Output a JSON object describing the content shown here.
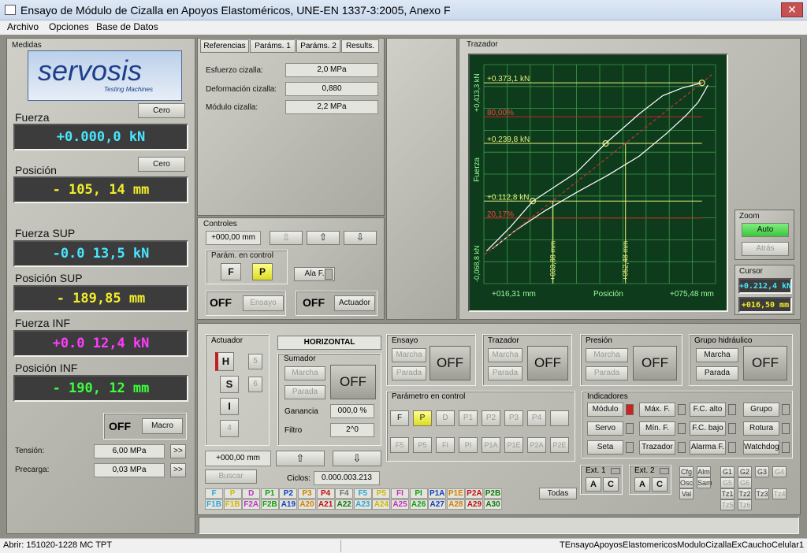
{
  "window": {
    "title": "Ensayo de Módulo de Cizalla en Apoyos Elastoméricos, UNE-EN 1337-3:2005, Anexo F",
    "close": "✕"
  },
  "menu": [
    "Archivo",
    "Opciones",
    "Base de Datos"
  ],
  "medidas": {
    "label": "Medidas",
    "logo": "servosis",
    "logo_sub": "Testing Machines",
    "cero": "Cero",
    "fuerza": {
      "label": "Fuerza",
      "value": "+0.000,0 kN"
    },
    "posicion": {
      "label": "Posición",
      "value": "- 105, 14 mm"
    },
    "fuerza_sup": {
      "label": "Fuerza SUP",
      "value": "-0.0 13,5 kN"
    },
    "posicion_sup": {
      "label": "Posición SUP",
      "value": "- 189,85 mm"
    },
    "fuerza_inf": {
      "label": "Fuerza INF",
      "value": "+0.0 12,4 kN"
    },
    "posicion_inf": {
      "label": "Posición INF",
      "value": "- 190, 12 mm"
    },
    "macro_state": "OFF",
    "macro": "Macro",
    "tension": {
      "label": "Tensión:",
      "value": "6,00 MPa"
    },
    "precarga": {
      "label": "Precarga:",
      "value": "0,03 MPa"
    },
    "arrow": ">>"
  },
  "tabs": [
    "Referencias",
    "Paráms. 1",
    "Paráms. 2",
    "Results."
  ],
  "results": [
    {
      "label": "Esfuerzo cizalla:",
      "value": "2,0 MPa"
    },
    {
      "label": "Deformación cizalla:",
      "value": "0,880"
    },
    {
      "label": "Módulo cizalla:",
      "value": "2,2 MPa"
    }
  ],
  "controles": {
    "label": "Controles",
    "pos": "+000,00 mm",
    "param_label": "Parám. en control",
    "f": "F",
    "p": "P",
    "alaf": "Ala F.",
    "ensayo_state": "OFF",
    "ensayo": "Ensayo",
    "act_state": "OFF",
    "actuador": "Actuador",
    "up": "⇧",
    "down": "⇩"
  },
  "trazador": {
    "label": "Trazador",
    "xlabel": "Posición",
    "ylabel": "Fuerza"
  },
  "chart_data": {
    "type": "line",
    "xlabel": "Posición",
    "ylabel": "Fuerza",
    "xlim": [
      16.31,
      75.48
    ],
    "ylim": [
      -0.0688,
      0.4133
    ],
    "x_ticks": [
      "+016,31 mm",
      "+075,48 mm"
    ],
    "y_ticks": [
      "-0,068,8 kN",
      "+0,413,3 kN"
    ],
    "series": [
      {
        "values": [
          [
            18.5,
            0.008
          ],
          [
            24,
            0.046
          ],
          [
            32,
            0.092
          ],
          [
            40,
            0.132
          ],
          [
            48,
            0.17
          ],
          [
            56,
            0.212
          ],
          [
            63,
            0.262
          ],
          [
            68,
            0.302
          ],
          [
            71,
            0.33
          ],
          [
            72.5,
            0.352
          ],
          [
            73.5,
            0.368
          ]
        ]
      },
      {
        "values": [
          [
            17,
            0.003
          ],
          [
            23,
            0.055
          ],
          [
            28.8,
            0.1128
          ],
          [
            40,
            0.176
          ],
          [
            47.4,
            0.2398
          ],
          [
            56,
            0.305
          ],
          [
            62,
            0.345
          ],
          [
            67,
            0.362
          ],
          [
            72,
            0.3731
          ]
        ]
      },
      {
        "values": [
          [
            16.5,
            -0.005
          ],
          [
            72,
            0.3731
          ],
          [
            75,
            0.395
          ]
        ]
      }
    ],
    "annotations": [
      "+0.373,1 kN",
      "80,00%",
      "+0.239,8 kN",
      "+0.112,8 kN",
      "20,17%",
      "+033,88 mm",
      "+052,48 mm"
    ],
    "hlines": [
      {
        "label": "+0.373,1 kN",
        "y": 0.3731
      },
      {
        "label": "80,00%",
        "y": 0.2985
      },
      {
        "label": "+0.239,8 kN",
        "y": 0.2398
      },
      {
        "label": "+0.112,8 kN",
        "y": 0.1128
      },
      {
        "label": "20,17%",
        "y": 0.0753
      }
    ],
    "vlines": [
      {
        "label": "+033,88 mm",
        "x": 33.88
      },
      {
        "label": "+052,48 mm",
        "x": 52.48
      }
    ],
    "markers": [
      [
        72,
        0.3731
      ],
      [
        47.4,
        0.2398
      ],
      [
        28.8,
        0.1128
      ]
    ],
    "grid": true,
    "colors": {
      "background": "#0e3b1c",
      "grid": "#3b9a4a",
      "curve": "#ffffff",
      "fit": "#c83232",
      "mark": "#e6f07a",
      "ticks": "#9aff9a"
    }
  },
  "zoom": {
    "label": "Zoom",
    "auto": "Auto",
    "atras": "Atrás"
  },
  "cursor": {
    "label": "Cursor",
    "force": "+0.212,4 kN",
    "pos": "+016,50 mm"
  },
  "actuador": {
    "label": "Actuador",
    "h": "H",
    "s": "S",
    "i": "I",
    "n4": "4",
    "n5": "5",
    "n6": "6",
    "pos": "+000,00 mm",
    "buscar": "Buscar"
  },
  "horizontal": "HORIZONTAL",
  "sumador": {
    "label": "Sumador",
    "marcha": "Marcha",
    "parada": "Parada",
    "state": "OFF",
    "ganancia_label": "Ganancia",
    "ganancia": "000,0 %",
    "filtro_label": "Filtro",
    "filtro": "2^0"
  },
  "ciclos": {
    "label": "Ciclos:",
    "value": "0.000.003.213"
  },
  "ensayo_grp": {
    "label": "Ensayo",
    "marcha": "Marcha",
    "parada": "Parada",
    "state": "OFF"
  },
  "trazador_grp": {
    "label": "Trazador",
    "marcha": "Marcha",
    "parada": "Parada",
    "state": "OFF"
  },
  "presion_grp": {
    "label": "Presión",
    "marcha": "Marcha",
    "parada": "Parada",
    "state": "OFF"
  },
  "hidraulico_grp": {
    "label": "Grupo hidráulico",
    "marcha": "Marcha",
    "parada": "Parada",
    "state": "OFF"
  },
  "param_control": {
    "label": "Parámetro en control",
    "row1": [
      "F",
      "P",
      "D",
      "P1",
      "P2",
      "P3",
      "P4",
      ""
    ],
    "row2": [
      "F5",
      "P5",
      "FI",
      "PI",
      "P1A",
      "P1E",
      "P2A",
      "P2E"
    ]
  },
  "indicadores": {
    "label": "Indicadores",
    "items": [
      "Módulo",
      "Máx. F.",
      "F.C. alto",
      "Grupo",
      "Servo",
      "Mín. F.",
      "F.C. bajo",
      "Rotura",
      "Seta",
      "Trazador",
      "Alarma F.",
      "Watchdog"
    ]
  },
  "ext1": {
    "label": "Ext. 1",
    "a": "A",
    "c": "C"
  },
  "ext2": {
    "label": "Ext. 2",
    "a": "A",
    "c": "C"
  },
  "mini": [
    "Cfg",
    "Alm",
    "Osc",
    "Sam",
    "Val",
    "G1",
    "G2",
    "G3",
    "G4",
    "G5",
    "G6",
    "Tz1",
    "Tz2",
    "Tz3",
    "Tz4",
    "Tz5",
    "Tz6"
  ],
  "todas": "Todas",
  "chips": [
    {
      "t": "F",
      "c": "#28a8d8"
    },
    {
      "t": "P",
      "c": "#d2b800"
    },
    {
      "t": "D",
      "c": "#c030c0"
    },
    {
      "t": "P1",
      "c": "#10a010"
    },
    {
      "t": "P2",
      "c": "#1040c0"
    },
    {
      "t": "P3",
      "c": "#d08000"
    },
    {
      "t": "P4",
      "c": "#c01010"
    },
    {
      "t": "F4",
      "c": "#707070"
    },
    {
      "t": "F5",
      "c": "#28a8d8"
    },
    {
      "t": "P5",
      "c": "#d2b800"
    },
    {
      "t": "FI",
      "c": "#c030c0"
    },
    {
      "t": "PI",
      "c": "#10a010"
    },
    {
      "t": "P1A",
      "c": "#1040c0"
    },
    {
      "t": "P1E",
      "c": "#d08000"
    },
    {
      "t": "P2A",
      "c": "#c01010"
    },
    {
      "t": "P2B",
      "c": "#0a7a0a"
    },
    {
      "t": "F1B",
      "c": "#28a8d8"
    },
    {
      "t": "F1B",
      "c": "#d2b800"
    },
    {
      "t": "F2A",
      "c": "#c030c0"
    },
    {
      "t": "F2B",
      "c": "#10a010"
    },
    {
      "t": "A19",
      "c": "#1040c0"
    },
    {
      "t": "A20",
      "c": "#d08000"
    },
    {
      "t": "A21",
      "c": "#c01010"
    },
    {
      "t": "A22",
      "c": "#0a7a0a"
    },
    {
      "t": "A23",
      "c": "#28a8d8"
    },
    {
      "t": "A24",
      "c": "#d2b800"
    },
    {
      "t": "A25",
      "c": "#c030c0"
    },
    {
      "t": "A26",
      "c": "#10a010"
    },
    {
      "t": "A27",
      "c": "#1040c0"
    },
    {
      "t": "A28",
      "c": "#d08000"
    },
    {
      "t": "A29",
      "c": "#c01010"
    },
    {
      "t": "A30",
      "c": "#0a7a0a"
    }
  ],
  "status": {
    "left": "Abrir: 151020-1228 MC TPT",
    "right": "TEnsayoApoyosElastomericosModuloCizallaExCauchoCelular1"
  }
}
